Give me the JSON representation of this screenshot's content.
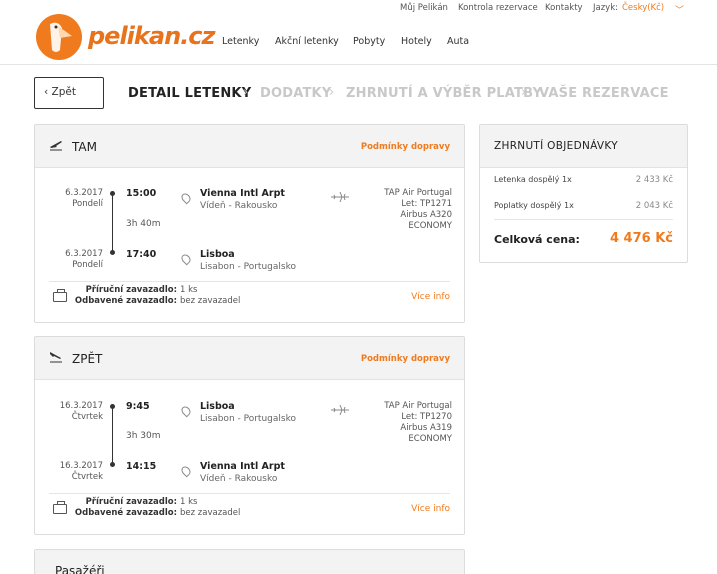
{
  "topbar": {
    "account": "Můj Pelikán",
    "check_reservation": "Kontrola rezervace",
    "contacts": "Kontakty",
    "language_label": "Jazyk:",
    "language_value": "Česky(Kč)"
  },
  "logo": {
    "text": "pelikan.cz"
  },
  "nav": [
    "Letenky",
    "Akční letenky",
    "Pobyty",
    "Hotely",
    "Auta"
  ],
  "back_label": "Zpět",
  "steps": [
    "DETAIL LETENKY",
    "DODATKY",
    "ZHRNUTÍ A VÝBĚR PLATBY",
    "VAŠE REZERVACE"
  ],
  "step_separator": "›",
  "outbound": {
    "title": "TAM",
    "conditions": "Podmínky dopravy",
    "dep_date": "6.3.2017",
    "dep_day": "Pondelí",
    "dep_time": "15:00",
    "duration": "3h 40m",
    "arr_date": "6.3.2017",
    "arr_day": "Pondelí",
    "arr_time": "17:40",
    "from_airport": "Vienna Intl Arpt",
    "from_city": "Vídeň - Rakousko",
    "to_airport": "Lisboa",
    "to_city": "Lisabon - Portugalsko",
    "airline": "TAP Air Portugal",
    "flight": "Let: TP1271",
    "aircraft": "Airbus A320",
    "cabin": "ECONOMY",
    "hand_bag_label": "Příruční zavazadlo:",
    "hand_bag_value": "1 ks",
    "checked_bag_label": "Odbavené zavazadlo:",
    "checked_bag_value": "bez zavazadel",
    "more_info": "Více info"
  },
  "inbound": {
    "title": "ZPĚT",
    "conditions": "Podmínky dopravy",
    "dep_date": "16.3.2017",
    "dep_day": "Čtvrtek",
    "dep_time": "9:45",
    "duration": "3h 30m",
    "arr_date": "16.3.2017",
    "arr_day": "Čtvrtek",
    "arr_time": "14:15",
    "from_airport": "Lisboa",
    "from_city": "Lisabon - Portugalsko",
    "to_airport": "Vienna Intl Arpt",
    "to_city": "Vídeň - Rakousko",
    "airline": "TAP Air Portugal",
    "flight": "Let: TP1270",
    "aircraft": "Airbus A319",
    "cabin": "ECONOMY",
    "hand_bag_label": "Příruční zavazadlo:",
    "hand_bag_value": "1 ks",
    "checked_bag_label": "Odbavené zavazadlo:",
    "checked_bag_value": "bez zavazadel",
    "more_info": "Více info"
  },
  "passengers": {
    "title": "Pasažéři"
  },
  "summary": {
    "title": "ZHRNUTÍ OBJEDNÁVKY",
    "ticket_label": "Letenka dospělý 1x",
    "ticket_price": "2 433 Kč",
    "fees_label": "Poplatky dospělý 1x",
    "fees_price": "2 043 Kč",
    "total_label": "Celková cena:",
    "total_price": "4 476 Kč"
  },
  "colors": {
    "accent": "#f07b1f",
    "muted_step": "#c8c8c8"
  },
  "icons": {
    "takeoff": "airplane-takeoff-icon",
    "landing": "airplane-landing-icon",
    "location": "map-pin-icon",
    "aircraft": "jet-icon",
    "baggage": "suitcase-icon"
  }
}
